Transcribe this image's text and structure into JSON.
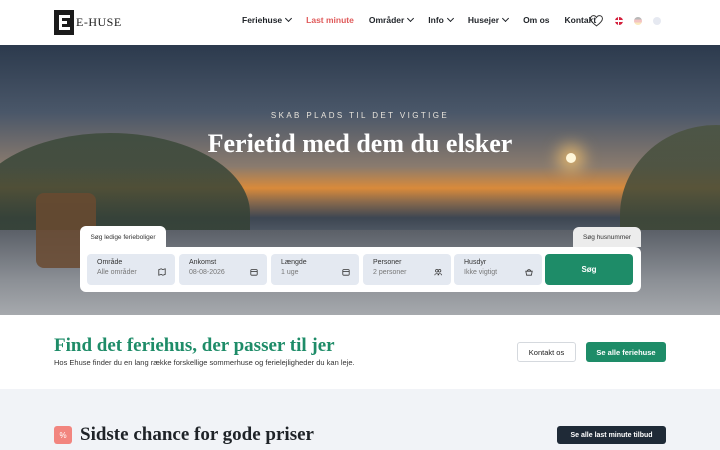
{
  "brand": {
    "name": "E-HUSE"
  },
  "nav": {
    "items": [
      {
        "label": "Feriehuse",
        "dropdown": true
      },
      {
        "label": "Last minute",
        "dropdown": false,
        "highlight_color": "#e05a5a"
      },
      {
        "label": "Områder",
        "dropdown": true
      },
      {
        "label": "Info",
        "dropdown": true
      },
      {
        "label": "Husejer",
        "dropdown": true
      },
      {
        "label": "Om os",
        "dropdown": false
      },
      {
        "label": "Kontakt",
        "dropdown": false
      }
    ],
    "icons": [
      "heart-icon",
      "flag-dk-icon",
      "flag-de-icon",
      "flag-gb-icon"
    ]
  },
  "hero": {
    "kicker": "SKAB PLADS TIL DET VIGTIGE",
    "title": "Ferietid med dem du elsker"
  },
  "search": {
    "tab_left": "Søg ledige ferieboliger",
    "tab_right": "Søg husnummer",
    "fields": [
      {
        "label": "Område",
        "value": "Alle områder",
        "icon": "map-icon"
      },
      {
        "label": "Ankomst",
        "value": "08-08-2026",
        "icon": "calendar-icon"
      },
      {
        "label": "Længde",
        "value": "1 uge",
        "icon": "calendar-icon"
      },
      {
        "label": "Personer",
        "value": "2 personer",
        "icon": "people-icon"
      },
      {
        "label": "Husdyr",
        "value": "Ikke vigtigt",
        "icon": "pet-basket-icon"
      }
    ],
    "submit_label": "Søg"
  },
  "find": {
    "title": "Find det feriehus, der passer til jer",
    "subtitle": "Hos Ehuse finder du en lang række forskellige sommerhuse og ferielejligheder du kan leje.",
    "contact_label": "Kontakt os",
    "all_label": "Se alle feriehuse"
  },
  "last_chance": {
    "badge": "%",
    "title": "Sidste chance for gode priser",
    "button_label": "Se alle last minute tilbud"
  },
  "colors": {
    "accent": "#1e8c68",
    "highlight": "#e05a5a",
    "dark": "#1f2a37"
  }
}
